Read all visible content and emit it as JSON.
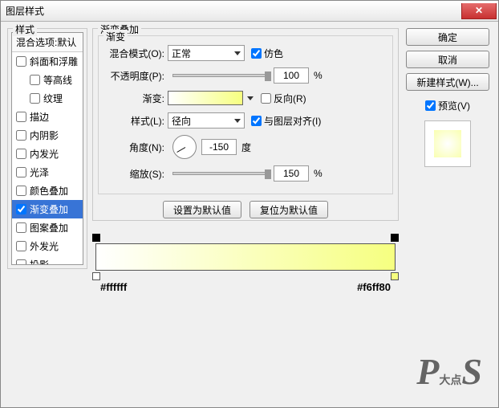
{
  "title": "图层样式",
  "styles_panel": {
    "heading": "样式",
    "blend_options": "混合选项:默认",
    "items": [
      {
        "label": "斜面和浮雕",
        "checked": false,
        "indent": false
      },
      {
        "label": "等高线",
        "checked": false,
        "indent": true
      },
      {
        "label": "纹理",
        "checked": false,
        "indent": true
      },
      {
        "label": "描边",
        "checked": false,
        "indent": false
      },
      {
        "label": "内阴影",
        "checked": false,
        "indent": false
      },
      {
        "label": "内发光",
        "checked": false,
        "indent": false
      },
      {
        "label": "光泽",
        "checked": false,
        "indent": false
      },
      {
        "label": "颜色叠加",
        "checked": false,
        "indent": false
      },
      {
        "label": "渐变叠加",
        "checked": true,
        "indent": false,
        "selected": true
      },
      {
        "label": "图案叠加",
        "checked": false,
        "indent": false
      },
      {
        "label": "外发光",
        "checked": false,
        "indent": false
      },
      {
        "label": "投影",
        "checked": false,
        "indent": false
      }
    ]
  },
  "center": {
    "heading": "渐变叠加",
    "group": "渐变",
    "blend_mode_label": "混合模式(O):",
    "blend_mode_value": "正常",
    "dither_label": "仿色",
    "dither_checked": true,
    "opacity_label": "不透明度(P):",
    "opacity_value": "100",
    "opacity_unit": "%",
    "gradient_label": "渐变:",
    "reverse_label": "反向(R)",
    "reverse_checked": false,
    "style_label": "样式(L):",
    "style_value": "径向",
    "align_label": "与图层对齐(I)",
    "align_checked": true,
    "angle_label": "角度(N):",
    "angle_value": "-150",
    "angle_unit": "度",
    "scale_label": "缩放(S):",
    "scale_value": "150",
    "scale_unit": "%",
    "set_default": "设置为默认值",
    "reset_default": "复位为默认值"
  },
  "gradient": {
    "stop_left": "#ffffff",
    "stop_right": "#f6ff80"
  },
  "right": {
    "ok": "确定",
    "cancel": "取消",
    "new_style": "新建样式(W)...",
    "preview_label": "预览(V)",
    "preview_checked": true
  }
}
